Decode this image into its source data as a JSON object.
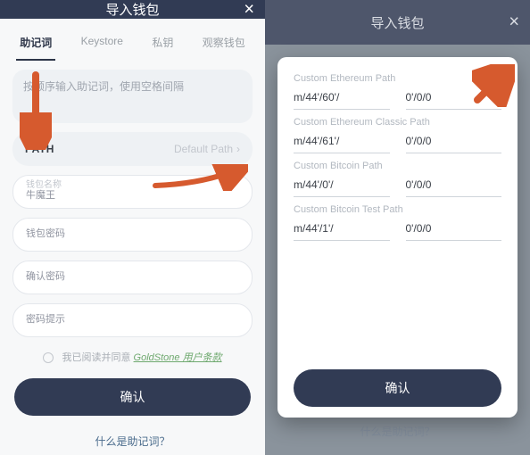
{
  "colors": {
    "primary": "#313b54",
    "link": "#4a6b8c",
    "terms": "#6fa96f"
  },
  "header": {
    "title": "导入钱包"
  },
  "tabs": [
    "助记词",
    "Keystore",
    "私钥",
    "观察钱包"
  ],
  "mnemonic_placeholder": "按顺序输入助记词，使用空格间隔",
  "path": {
    "label": "PATH",
    "value": "Default Path"
  },
  "fields": {
    "name_label": "钱包名称",
    "name_value": "牛魔王",
    "pwd_label": "钱包密码",
    "confirm_label": "确认密码",
    "hint_label": "密码提示"
  },
  "agree": {
    "prefix": "我已阅读并同意",
    "terms": "GoldStone 用户条款"
  },
  "confirm_label": "确认",
  "bottom_link": "什么是助记词？",
  "modal": {
    "sections": [
      {
        "title": "Custom Ethereum Path",
        "left": "m/44'/60'/",
        "right": "0'/0/0"
      },
      {
        "title": "Custom Ethereum Classic Path",
        "left": "m/44'/61'/",
        "right": "0'/0/0"
      },
      {
        "title": "Custom Bitcoin Path",
        "left": "m/44'/0'/",
        "right": "0'/0/0"
      },
      {
        "title": "Custom Bitcoin Test Path",
        "left": "m/44'/1'/",
        "right": "0'/0/0"
      }
    ],
    "confirm": "确认"
  },
  "chevron": "›"
}
